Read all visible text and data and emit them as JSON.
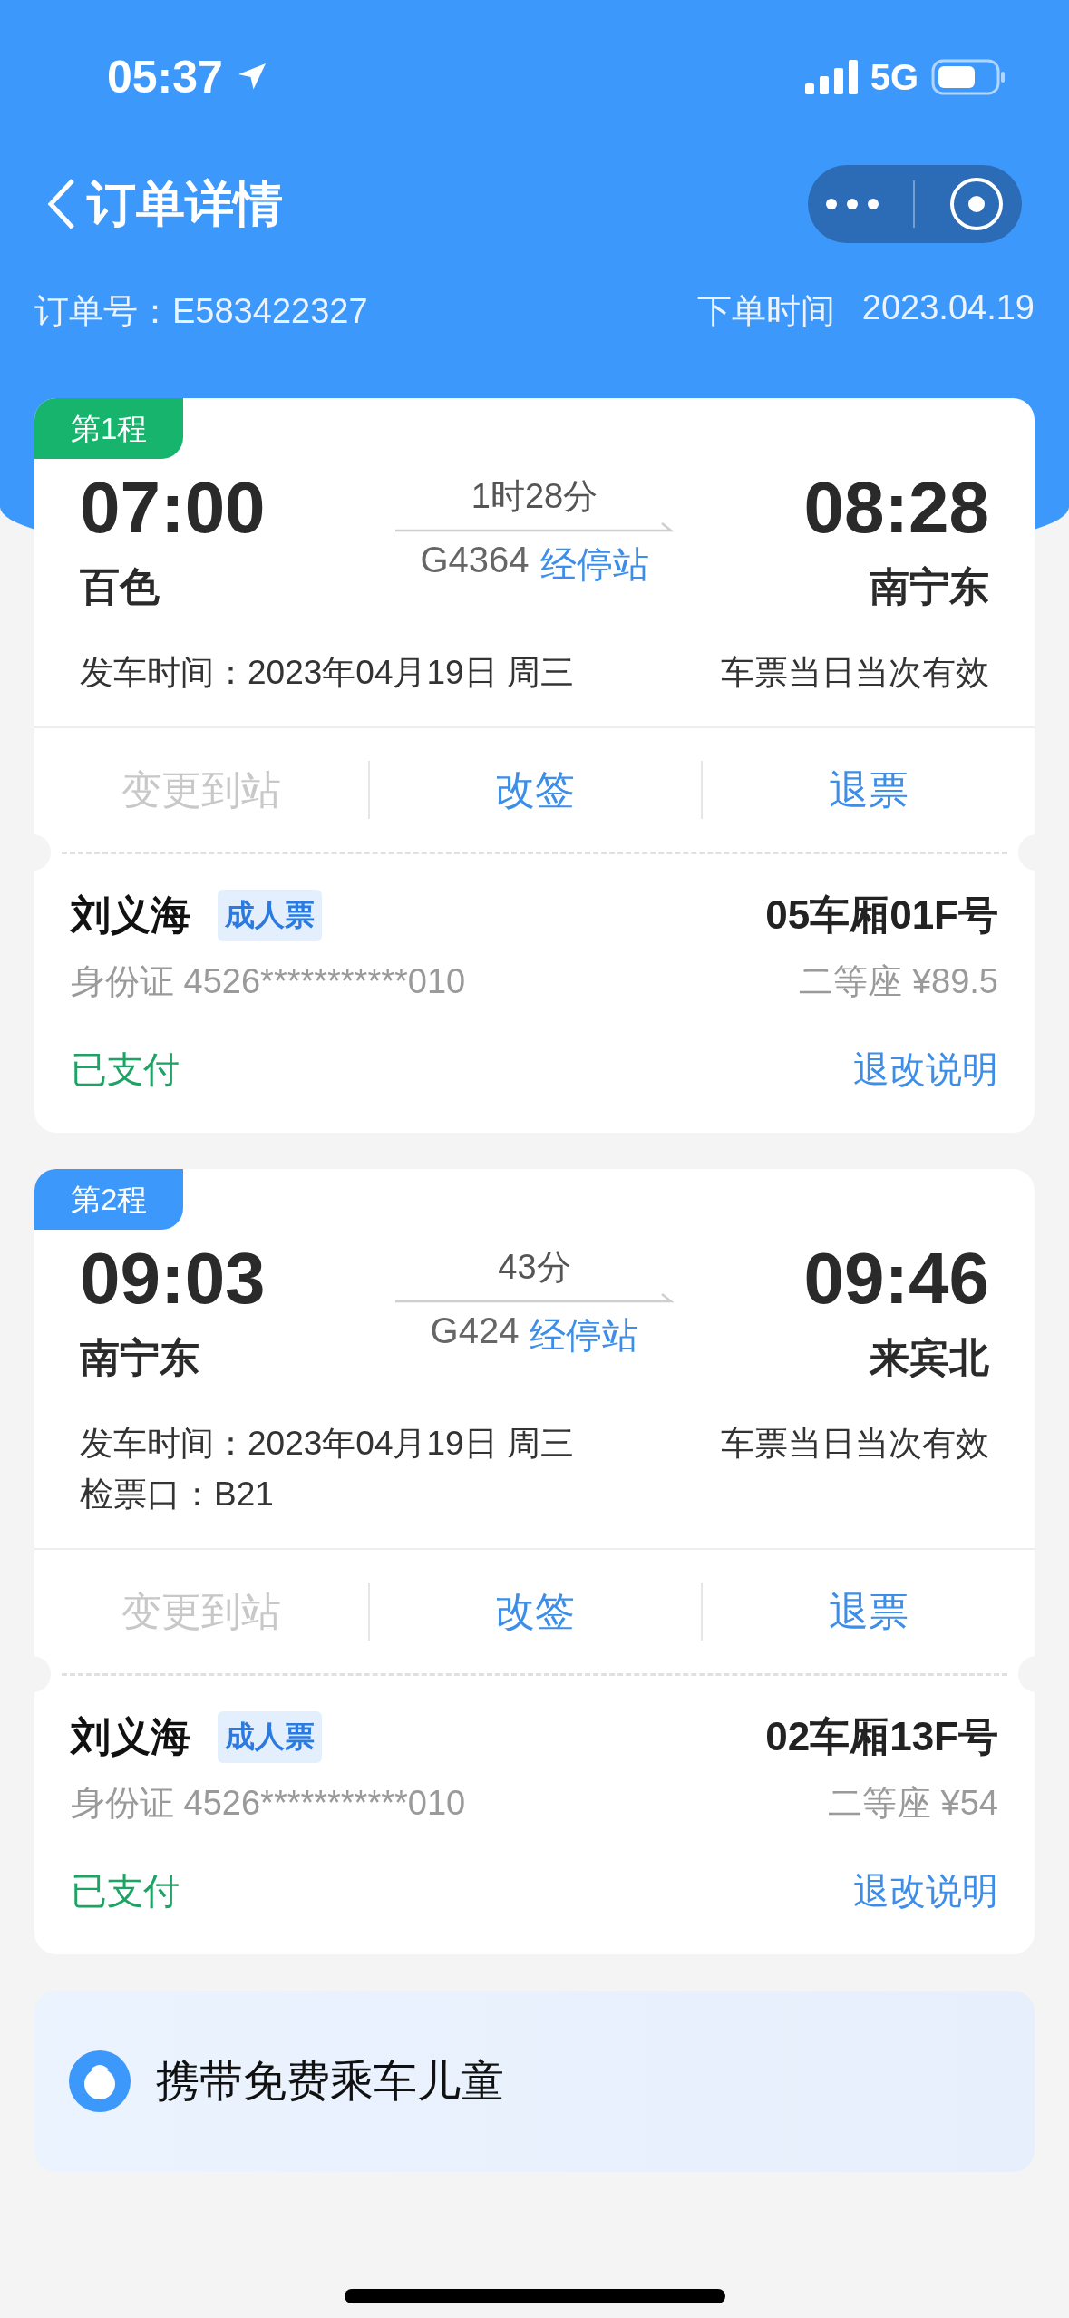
{
  "status_bar": {
    "time": "05:37",
    "network": "5G"
  },
  "nav": {
    "title": "订单详情"
  },
  "order": {
    "number_label": "订单号：",
    "number": "E583422327",
    "time_label": "下单时间",
    "time": "2023.04.19"
  },
  "trips": [
    {
      "tag": "第1程",
      "color": "#16b46c",
      "depart_time": "07:00",
      "depart_station": "百色",
      "duration": "1时28分",
      "train": "G4364",
      "stops_link": "经停站",
      "arrive_time": "08:28",
      "arrive_station": "南宁东",
      "departure": "发车时间：2023年04月19日 周三",
      "validity": "车票当日当次有效",
      "actions": [
        {
          "label": "变更到站",
          "disabled": true
        },
        {
          "label": "改签",
          "disabled": false
        },
        {
          "label": "退票",
          "disabled": false
        }
      ],
      "passenger": {
        "name": "刘义海",
        "ticket_type": "成人票",
        "id": "身份证 4526***********010",
        "seat": "05车厢01F号",
        "fare": "二等座 ¥89.5",
        "status": "已支付",
        "rules_link": "退改说明"
      }
    },
    {
      "tag": "第2程",
      "color": "#3d98fb",
      "depart_time": "09:03",
      "depart_station": "南宁东",
      "duration": "43分",
      "train": "G424",
      "stops_link": "经停站",
      "arrive_time": "09:46",
      "arrive_station": "来宾北",
      "departure": "发车时间：2023年04月19日 周三",
      "validity": "车票当日当次有效",
      "gate": "检票口：B21",
      "actions": [
        {
          "label": "变更到站",
          "disabled": true
        },
        {
          "label": "改签",
          "disabled": false
        },
        {
          "label": "退票",
          "disabled": false
        }
      ],
      "passenger": {
        "name": "刘义海",
        "ticket_type": "成人票",
        "id": "身份证 4526***********010",
        "seat": "02车厢13F号",
        "fare": "二等座 ¥54",
        "status": "已支付",
        "rules_link": "退改说明"
      }
    }
  ],
  "child": {
    "label": "携带免费乘车儿童"
  }
}
